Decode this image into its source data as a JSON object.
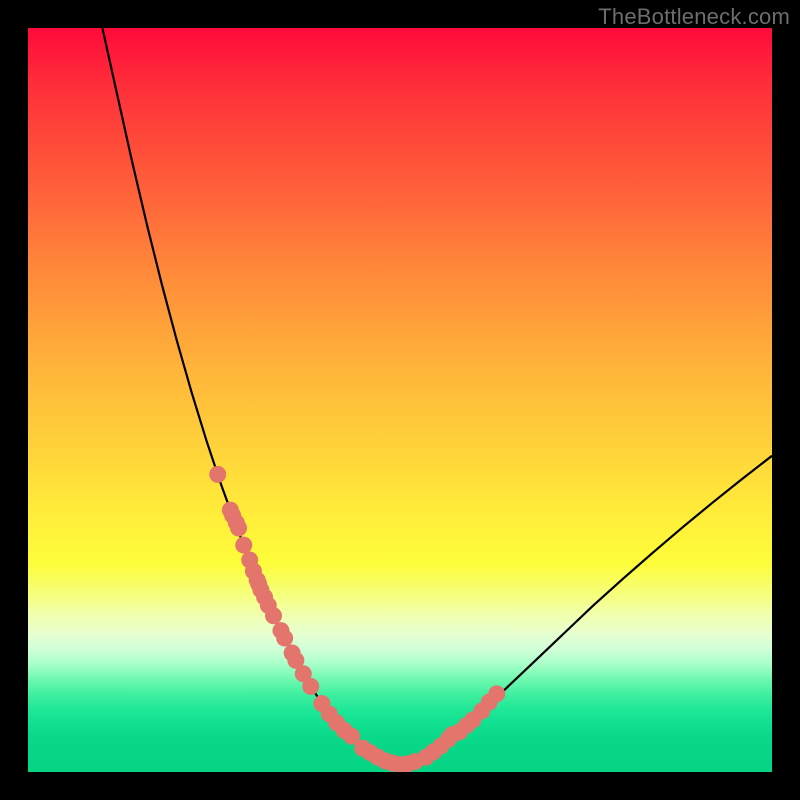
{
  "watermark": "TheBottleneck.com",
  "chart_data": {
    "type": "line",
    "title": "",
    "xlabel": "",
    "ylabel": "",
    "xlim": [
      0,
      100
    ],
    "ylim": [
      0,
      100
    ],
    "series": [
      {
        "name": "curve",
        "x": [
          10,
          12,
          14,
          16,
          18,
          20,
          22,
          24,
          26,
          28,
          30,
          31,
          32,
          33,
          34,
          35,
          36,
          37,
          38,
          39,
          40,
          42,
          44,
          46,
          48,
          50,
          52,
          54,
          56,
          58,
          60,
          64,
          68,
          72,
          76,
          80,
          84,
          88,
          92,
          96,
          100
        ],
        "y": [
          100,
          91,
          82,
          73.5,
          65.5,
          58,
          51,
          44.5,
          38.5,
          33,
          28,
          25.7,
          23.4,
          21.2,
          19,
          17,
          15,
          13.2,
          11.5,
          10,
          8.6,
          6.2,
          4.2,
          2.6,
          1.5,
          1,
          1.4,
          2.4,
          3.8,
          5.4,
          7.2,
          11,
          14.8,
          18.6,
          22.4,
          26,
          29.5,
          32.9,
          36.2,
          39.4,
          42.5
        ]
      },
      {
        "name": "markers",
        "x": [
          25.5,
          27.2,
          27.5,
          28.0,
          28.3,
          29.0,
          29.8,
          30.3,
          30.8,
          31.0,
          31.3,
          31.8,
          32.3,
          33.0,
          34.0,
          34.5,
          35.5,
          36.0,
          37.0,
          38.0,
          39.5,
          40.5,
          41.5,
          42.5,
          43.5,
          45.0,
          46.0,
          47.0,
          48.0,
          49.0,
          50.0,
          51.0,
          52.0,
          53.5,
          54.5,
          55.5,
          56.5,
          57.0,
          58.0,
          59.0,
          59.8,
          61.0,
          62.0,
          63.0
        ],
        "y": [
          40.0,
          35.2,
          34.5,
          33.5,
          32.8,
          30.5,
          28.5,
          27.0,
          25.8,
          25.3,
          24.5,
          23.5,
          22.4,
          21.0,
          19.0,
          18.0,
          16.0,
          15.0,
          13.2,
          11.5,
          9.2,
          7.8,
          6.6,
          5.6,
          4.8,
          3.2,
          2.6,
          2.0,
          1.5,
          1.2,
          1.0,
          1.1,
          1.4,
          2.0,
          2.7,
          3.5,
          4.4,
          5.0,
          5.4,
          6.3,
          7.0,
          8.2,
          9.4,
          10.5
        ]
      }
    ],
    "colors": {
      "curve": "#000000",
      "markers": "#e3756c"
    }
  }
}
